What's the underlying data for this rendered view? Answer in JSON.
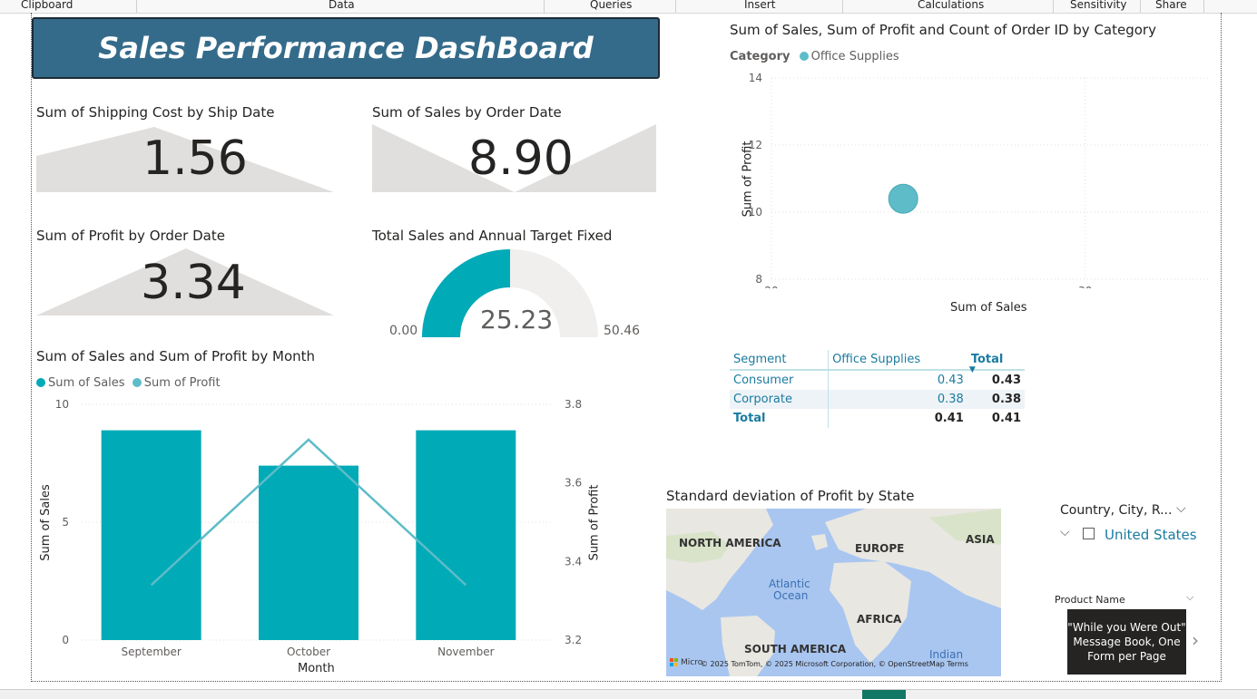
{
  "ribbon": {
    "labels": [
      "Clipboard",
      "Data",
      "Queries",
      "Insert",
      "Calculations",
      "Sensitivity",
      "Share"
    ]
  },
  "dashboard_title": "Sales Performance DashBoard",
  "kpis": {
    "shipping": {
      "title": "Sum of Shipping Cost by Ship Date",
      "value": "1.56"
    },
    "sales": {
      "title": "Sum of Sales by Order Date",
      "value": "8.90"
    },
    "profit": {
      "title": "Sum of Profit by Order Date",
      "value": "3.34"
    }
  },
  "gauge": {
    "title": "Total Sales and Annual Target Fixed",
    "value": "25.23",
    "min": "0.00",
    "max": "50.46",
    "fraction": 0.5,
    "color": "#00aab7"
  },
  "scatter": {
    "title": "Sum of Sales, Sum of Profit and Count of Order ID by Category",
    "legend_label": "Category",
    "legend_item": "Office Supplies",
    "xlabel": "Sum of Sales",
    "ylabel": "Sum of Profit",
    "xticks": [
      "20",
      "30"
    ],
    "yticks": [
      "14",
      "12",
      "10",
      "8"
    ]
  },
  "matrix": {
    "headers": [
      "Segment",
      "Office Supplies",
      "Total"
    ],
    "rows": [
      {
        "segment": "Consumer",
        "value": "0.43",
        "total": "0.43"
      },
      {
        "segment": "Corporate",
        "value": "0.38",
        "total": "0.38"
      },
      {
        "segment": "Total",
        "value": "0.41",
        "total": "0.41"
      }
    ]
  },
  "combo": {
    "title": "Sum of Sales and Sum of Profit by Month",
    "legend": [
      "Sum of Sales",
      "Sum of Profit"
    ],
    "xlabel": "Month",
    "ylabel_left": "Sum of Sales",
    "ylabel_right": "Sum of Profit",
    "left_ticks": [
      "10",
      "5",
      "0"
    ],
    "right_ticks": [
      "3.8",
      "3.6",
      "3.4",
      "3.2"
    ]
  },
  "map": {
    "title": "Standard deviation of Profit by State",
    "labels": {
      "north_america": "NORTH AMERICA",
      "europe": "EUROPE",
      "asia": "ASIA",
      "atlantic": "Atlantic",
      "ocean": "Ocean",
      "africa": "AFRICA",
      "south_america": "SOUTH AMERICA",
      "indian": "Indian"
    },
    "attribution": "© 2025 TomTom, © 2025 Microsoft Corporation, © OpenStreetMap  Terms",
    "ms_logo_text": "Micro"
  },
  "slicer": {
    "header": "Country, City, R...",
    "item": "United States"
  },
  "product": {
    "header": "Product Name",
    "tooltip": "\"While you Were Out\" Message Book, One Form per Page"
  },
  "chart_data": [
    {
      "type": "bar",
      "title": "Sum of Sales and Sum of Profit by Month",
      "categories": [
        "September",
        "October",
        "November"
      ],
      "series": [
        {
          "name": "Sum of Sales",
          "type": "bar",
          "axis": "left",
          "values": [
            8.9,
            7.4,
            8.9
          ],
          "color": "#00aab7"
        },
        {
          "name": "Sum of Profit",
          "type": "line",
          "axis": "right",
          "values": [
            3.34,
            3.71,
            3.34
          ],
          "color": "#5dbcc8"
        }
      ],
      "xlabel": "Month",
      "ylabel": "Sum of Sales",
      "ylim": [
        0,
        10
      ],
      "y2label": "Sum of Profit",
      "y2lim": [
        3.2,
        3.8
      ]
    },
    {
      "type": "scatter",
      "title": "Sum of Sales, Sum of Profit and Count of Order ID by Category",
      "series": [
        {
          "name": "Office Supplies",
          "x": [
            24.2
          ],
          "y": [
            10.4
          ],
          "color": "#5dbcc8"
        }
      ],
      "xlabel": "Sum of Sales",
      "ylabel": "Sum of Profit",
      "xlim": [
        20,
        34
      ],
      "ylim": [
        8,
        14
      ]
    }
  ]
}
